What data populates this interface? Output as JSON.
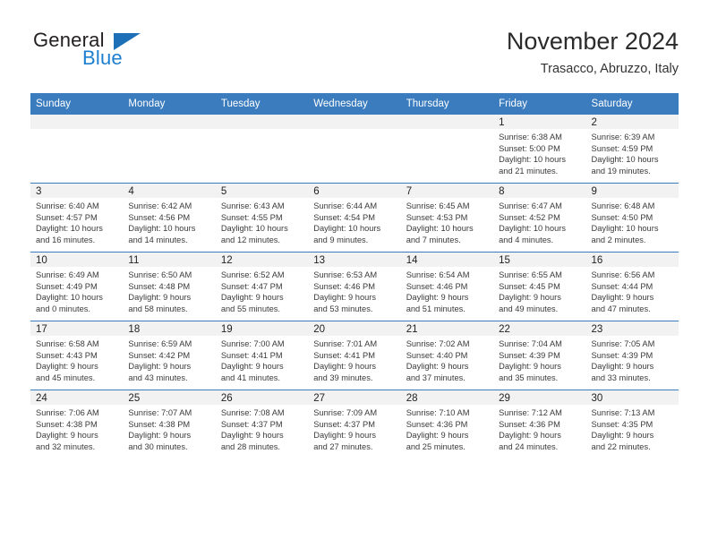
{
  "brand": {
    "general": "General",
    "blue": "Blue",
    "triangle_color": "#1d6fb8",
    "blue_color": "#1d7fd0"
  },
  "header": {
    "title": "November 2024",
    "subtitle": "Trasacco, Abruzzo, Italy"
  },
  "theme": {
    "header_bar": "#3a7cbe",
    "daynum_band": "#f2f2f2",
    "text": "#3a3a3a"
  },
  "weekdays": [
    "Sunday",
    "Monday",
    "Tuesday",
    "Wednesday",
    "Thursday",
    "Friday",
    "Saturday"
  ],
  "weeks": [
    [
      {
        "day": "",
        "empty": true
      },
      {
        "day": "",
        "empty": true
      },
      {
        "day": "",
        "empty": true
      },
      {
        "day": "",
        "empty": true
      },
      {
        "day": "",
        "empty": true
      },
      {
        "day": "1",
        "sunrise": "Sunrise: 6:38 AM",
        "sunset": "Sunset: 5:00 PM",
        "daylight1": "Daylight: 10 hours",
        "daylight2": "and 21 minutes."
      },
      {
        "day": "2",
        "sunrise": "Sunrise: 6:39 AM",
        "sunset": "Sunset: 4:59 PM",
        "daylight1": "Daylight: 10 hours",
        "daylight2": "and 19 minutes."
      }
    ],
    [
      {
        "day": "3",
        "sunrise": "Sunrise: 6:40 AM",
        "sunset": "Sunset: 4:57 PM",
        "daylight1": "Daylight: 10 hours",
        "daylight2": "and 16 minutes."
      },
      {
        "day": "4",
        "sunrise": "Sunrise: 6:42 AM",
        "sunset": "Sunset: 4:56 PM",
        "daylight1": "Daylight: 10 hours",
        "daylight2": "and 14 minutes."
      },
      {
        "day": "5",
        "sunrise": "Sunrise: 6:43 AM",
        "sunset": "Sunset: 4:55 PM",
        "daylight1": "Daylight: 10 hours",
        "daylight2": "and 12 minutes."
      },
      {
        "day": "6",
        "sunrise": "Sunrise: 6:44 AM",
        "sunset": "Sunset: 4:54 PM",
        "daylight1": "Daylight: 10 hours",
        "daylight2": "and 9 minutes."
      },
      {
        "day": "7",
        "sunrise": "Sunrise: 6:45 AM",
        "sunset": "Sunset: 4:53 PM",
        "daylight1": "Daylight: 10 hours",
        "daylight2": "and 7 minutes."
      },
      {
        "day": "8",
        "sunrise": "Sunrise: 6:47 AM",
        "sunset": "Sunset: 4:52 PM",
        "daylight1": "Daylight: 10 hours",
        "daylight2": "and 4 minutes."
      },
      {
        "day": "9",
        "sunrise": "Sunrise: 6:48 AM",
        "sunset": "Sunset: 4:50 PM",
        "daylight1": "Daylight: 10 hours",
        "daylight2": "and 2 minutes."
      }
    ],
    [
      {
        "day": "10",
        "sunrise": "Sunrise: 6:49 AM",
        "sunset": "Sunset: 4:49 PM",
        "daylight1": "Daylight: 10 hours",
        "daylight2": "and 0 minutes."
      },
      {
        "day": "11",
        "sunrise": "Sunrise: 6:50 AM",
        "sunset": "Sunset: 4:48 PM",
        "daylight1": "Daylight: 9 hours",
        "daylight2": "and 58 minutes."
      },
      {
        "day": "12",
        "sunrise": "Sunrise: 6:52 AM",
        "sunset": "Sunset: 4:47 PM",
        "daylight1": "Daylight: 9 hours",
        "daylight2": "and 55 minutes."
      },
      {
        "day": "13",
        "sunrise": "Sunrise: 6:53 AM",
        "sunset": "Sunset: 4:46 PM",
        "daylight1": "Daylight: 9 hours",
        "daylight2": "and 53 minutes."
      },
      {
        "day": "14",
        "sunrise": "Sunrise: 6:54 AM",
        "sunset": "Sunset: 4:46 PM",
        "daylight1": "Daylight: 9 hours",
        "daylight2": "and 51 minutes."
      },
      {
        "day": "15",
        "sunrise": "Sunrise: 6:55 AM",
        "sunset": "Sunset: 4:45 PM",
        "daylight1": "Daylight: 9 hours",
        "daylight2": "and 49 minutes."
      },
      {
        "day": "16",
        "sunrise": "Sunrise: 6:56 AM",
        "sunset": "Sunset: 4:44 PM",
        "daylight1": "Daylight: 9 hours",
        "daylight2": "and 47 minutes."
      }
    ],
    [
      {
        "day": "17",
        "sunrise": "Sunrise: 6:58 AM",
        "sunset": "Sunset: 4:43 PM",
        "daylight1": "Daylight: 9 hours",
        "daylight2": "and 45 minutes."
      },
      {
        "day": "18",
        "sunrise": "Sunrise: 6:59 AM",
        "sunset": "Sunset: 4:42 PM",
        "daylight1": "Daylight: 9 hours",
        "daylight2": "and 43 minutes."
      },
      {
        "day": "19",
        "sunrise": "Sunrise: 7:00 AM",
        "sunset": "Sunset: 4:41 PM",
        "daylight1": "Daylight: 9 hours",
        "daylight2": "and 41 minutes."
      },
      {
        "day": "20",
        "sunrise": "Sunrise: 7:01 AM",
        "sunset": "Sunset: 4:41 PM",
        "daylight1": "Daylight: 9 hours",
        "daylight2": "and 39 minutes."
      },
      {
        "day": "21",
        "sunrise": "Sunrise: 7:02 AM",
        "sunset": "Sunset: 4:40 PM",
        "daylight1": "Daylight: 9 hours",
        "daylight2": "and 37 minutes."
      },
      {
        "day": "22",
        "sunrise": "Sunrise: 7:04 AM",
        "sunset": "Sunset: 4:39 PM",
        "daylight1": "Daylight: 9 hours",
        "daylight2": "and 35 minutes."
      },
      {
        "day": "23",
        "sunrise": "Sunrise: 7:05 AM",
        "sunset": "Sunset: 4:39 PM",
        "daylight1": "Daylight: 9 hours",
        "daylight2": "and 33 minutes."
      }
    ],
    [
      {
        "day": "24",
        "sunrise": "Sunrise: 7:06 AM",
        "sunset": "Sunset: 4:38 PM",
        "daylight1": "Daylight: 9 hours",
        "daylight2": "and 32 minutes."
      },
      {
        "day": "25",
        "sunrise": "Sunrise: 7:07 AM",
        "sunset": "Sunset: 4:38 PM",
        "daylight1": "Daylight: 9 hours",
        "daylight2": "and 30 minutes."
      },
      {
        "day": "26",
        "sunrise": "Sunrise: 7:08 AM",
        "sunset": "Sunset: 4:37 PM",
        "daylight1": "Daylight: 9 hours",
        "daylight2": "and 28 minutes."
      },
      {
        "day": "27",
        "sunrise": "Sunrise: 7:09 AM",
        "sunset": "Sunset: 4:37 PM",
        "daylight1": "Daylight: 9 hours",
        "daylight2": "and 27 minutes."
      },
      {
        "day": "28",
        "sunrise": "Sunrise: 7:10 AM",
        "sunset": "Sunset: 4:36 PM",
        "daylight1": "Daylight: 9 hours",
        "daylight2": "and 25 minutes."
      },
      {
        "day": "29",
        "sunrise": "Sunrise: 7:12 AM",
        "sunset": "Sunset: 4:36 PM",
        "daylight1": "Daylight: 9 hours",
        "daylight2": "and 24 minutes."
      },
      {
        "day": "30",
        "sunrise": "Sunrise: 7:13 AM",
        "sunset": "Sunset: 4:35 PM",
        "daylight1": "Daylight: 9 hours",
        "daylight2": "and 22 minutes."
      }
    ]
  ]
}
